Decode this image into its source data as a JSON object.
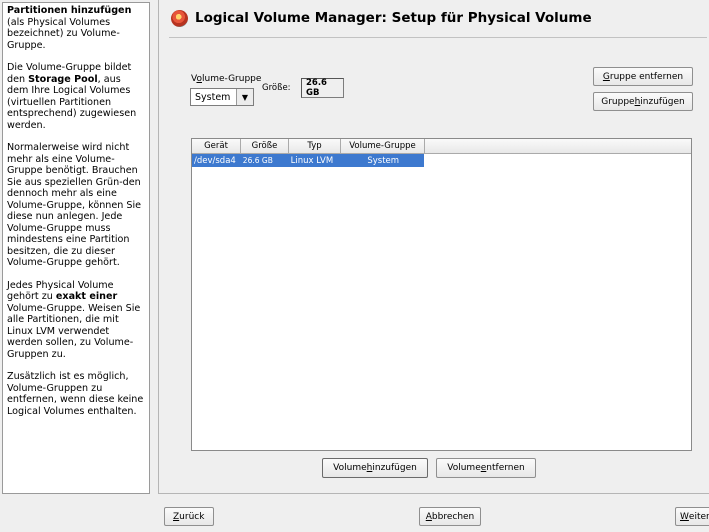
{
  "help": {
    "heading": "Partitionen hinzufügen",
    "intro": "(als Physical Volumes bezeichnet) zu Volume-Gruppe.",
    "p1_a": "Die Volume-Gruppe bildet den ",
    "p1_bold": "Storage Pool",
    "p1_b": ", aus dem Ihre Logical Volumes (virtuellen Partitionen entsprechend) zugewiesen werden.",
    "p2": "Normalerweise wird nicht mehr als eine Volume-Gruppe benötigt. Brauchen Sie aus speziellen Grün-den dennoch mehr als eine Volume-Gruppe, können Sie diese nun anlegen. Jede Volume-Gruppe muss mindestens eine Partition besitzen, die zu dieser Volume-Gruppe gehört.",
    "p3_a": "Jedes Physical Volume gehört zu ",
    "p3_bold": "exakt einer",
    "p3_b": " Volume-Gruppe. Weisen Sie alle Partitionen, die mit Linux LVM verwendet werden sollen, zu Volume-Gruppen zu.",
    "p4": "Zusätzlich ist es möglich, Volume-Gruppen zu entfernen, wenn diese keine Logical Volumes enthalten."
  },
  "window": {
    "title": "Logical Volume Manager: Setup für Physical Volume"
  },
  "volume_group": {
    "label_pre": "V",
    "label_ul": "o",
    "label_post": "lume-Gruppe",
    "selected": "System",
    "size_label": "Größe:",
    "size_value": "26.6 GB"
  },
  "buttons": {
    "remove_group_ul": "G",
    "remove_group_rest": "ruppe entfernen",
    "add_group_pre": "Gruppe ",
    "add_group_ul": "h",
    "add_group_post": "inzufügen",
    "add_volume_pre": "Volume ",
    "add_volume_ul": "h",
    "add_volume_post": "inzufügen",
    "remove_volume_pre": "Volume ",
    "remove_volume_ul": "e",
    "remove_volume_post": "ntfernen",
    "back_ul": "Z",
    "back_rest": "urück",
    "cancel_ul": "A",
    "cancel_rest": "bbrechen",
    "next_ul": "W",
    "next_rest": "eiter"
  },
  "table": {
    "columns": [
      "Gerät",
      "Größe",
      "Typ",
      "Volume-Gruppe"
    ],
    "rows": [
      [
        "/dev/sda4",
        "26.6 GB",
        "Linux LVM",
        "System"
      ]
    ]
  }
}
